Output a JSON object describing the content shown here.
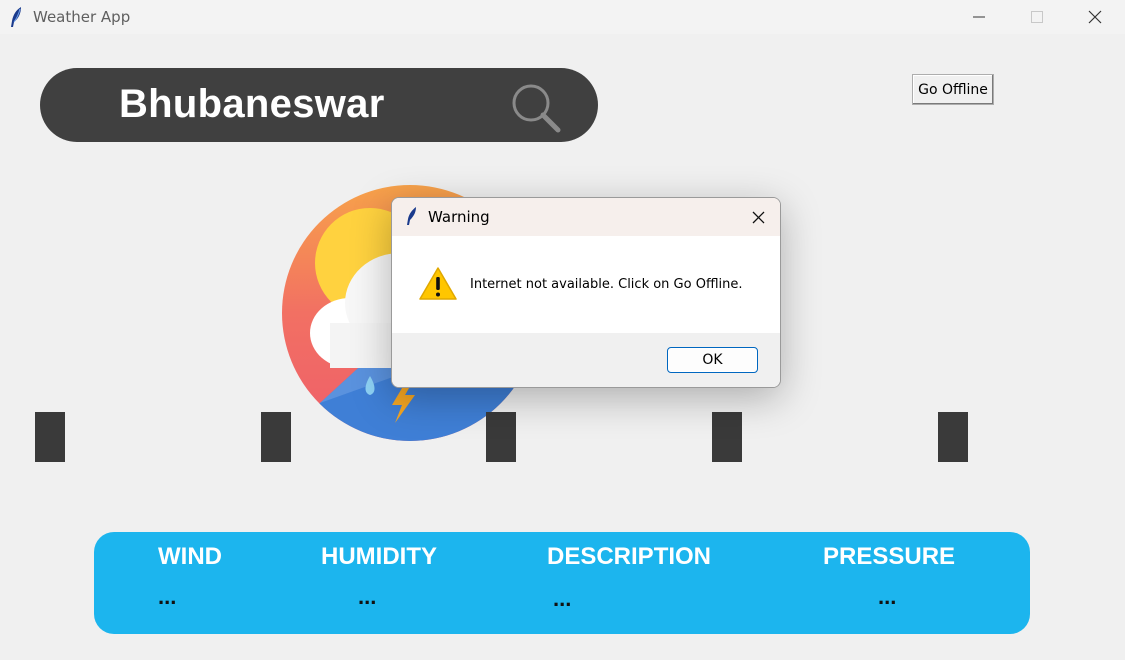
{
  "window": {
    "title": "Weather App",
    "icon": "feather-icon",
    "controls": [
      "minimize-icon",
      "maximize-icon",
      "close-icon"
    ]
  },
  "search": {
    "value": "Bhubaneswar",
    "icon": "search-icon"
  },
  "toolbar": {
    "go_offline_label": "Go Offline"
  },
  "info_panel": {
    "items": [
      {
        "label": "WIND",
        "value": "..."
      },
      {
        "label": "HUMIDITY",
        "value": "..."
      },
      {
        "label": "DESCRIPTION",
        "value": "..."
      },
      {
        "label": "PRESSURE",
        "value": "..."
      }
    ]
  },
  "dialog": {
    "title": "Warning",
    "message": "Internet not available. Click on Go Offline.",
    "ok_label": "OK",
    "icon": "warning-icon"
  },
  "colors": {
    "panel": "#1cb5ee",
    "search_bar": "#404040",
    "pillar": "#3a3a3a"
  }
}
